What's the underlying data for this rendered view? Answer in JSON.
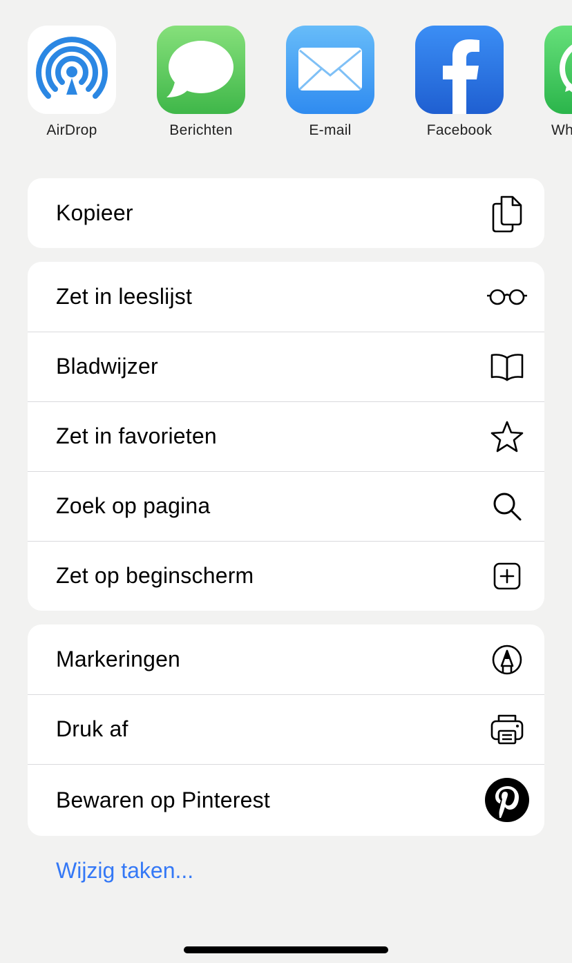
{
  "apps": [
    {
      "label": "AirDrop",
      "icon": "airdrop-icon",
      "color": "#2d89e5"
    },
    {
      "label": "Berichten",
      "icon": "messages-icon",
      "color": "#4cc451"
    },
    {
      "label": "E-mail",
      "icon": "mail-icon",
      "color": "#3a9af3"
    },
    {
      "label": "Facebook",
      "icon": "facebook-icon",
      "color": "#1e66d6"
    },
    {
      "label": "Wh",
      "icon": "whatsapp-icon",
      "color": "#3cc458"
    }
  ],
  "group1": [
    {
      "label": "Kopieer",
      "icon": "copy-icon"
    }
  ],
  "group2": [
    {
      "label": "Zet in leeslijst",
      "icon": "glasses-icon"
    },
    {
      "label": "Bladwijzer",
      "icon": "book-icon"
    },
    {
      "label": "Zet in favorieten",
      "icon": "star-icon"
    },
    {
      "label": "Zoek op pagina",
      "icon": "search-icon"
    },
    {
      "label": "Zet op beginscherm",
      "icon": "plus-square-icon"
    }
  ],
  "group3": [
    {
      "label": "Markeringen",
      "icon": "markup-icon"
    },
    {
      "label": "Druk af",
      "icon": "printer-icon"
    },
    {
      "label": "Bewaren op Pinterest",
      "icon": "pinterest-icon"
    }
  ],
  "edit_actions": "Wijzig taken...",
  "accent_color": "#3478f6"
}
